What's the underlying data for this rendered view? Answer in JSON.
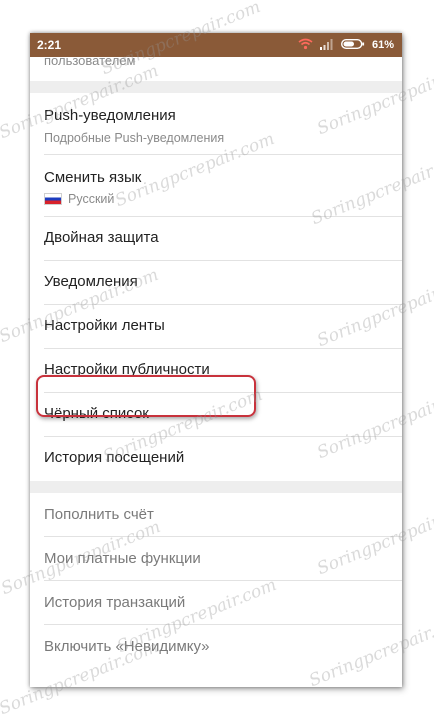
{
  "status_bar": {
    "time": "2:21",
    "battery_percent": "61%",
    "icons": [
      "wifi-icon",
      "signal-icon",
      "battery-icon"
    ],
    "color": "#8a5a38"
  },
  "top_cut_text": "пользователем",
  "group1": [
    {
      "title": "Push-уведомления",
      "subtitle": "Подробные Push-уведомления"
    },
    {
      "title": "Сменить язык",
      "subtitle": "Русский",
      "flag": "russia-flag-icon"
    },
    {
      "title": "Двойная защита"
    },
    {
      "title": "Уведомления"
    },
    {
      "title": "Настройки ленты"
    },
    {
      "title": "Настройки публичности",
      "highlighted": true
    },
    {
      "title": "Чёрный список"
    },
    {
      "title": "История посещений"
    }
  ],
  "group2": [
    {
      "title": "Пополнить счёт"
    },
    {
      "title": "Мои платные функции"
    },
    {
      "title": "История транзакций"
    },
    {
      "title": "Включить «Невидимку»"
    }
  ],
  "watermark": "Soringpcrepair.com",
  "colors": {
    "highlight": "#c8323c",
    "separator": "#eeeeee"
  }
}
